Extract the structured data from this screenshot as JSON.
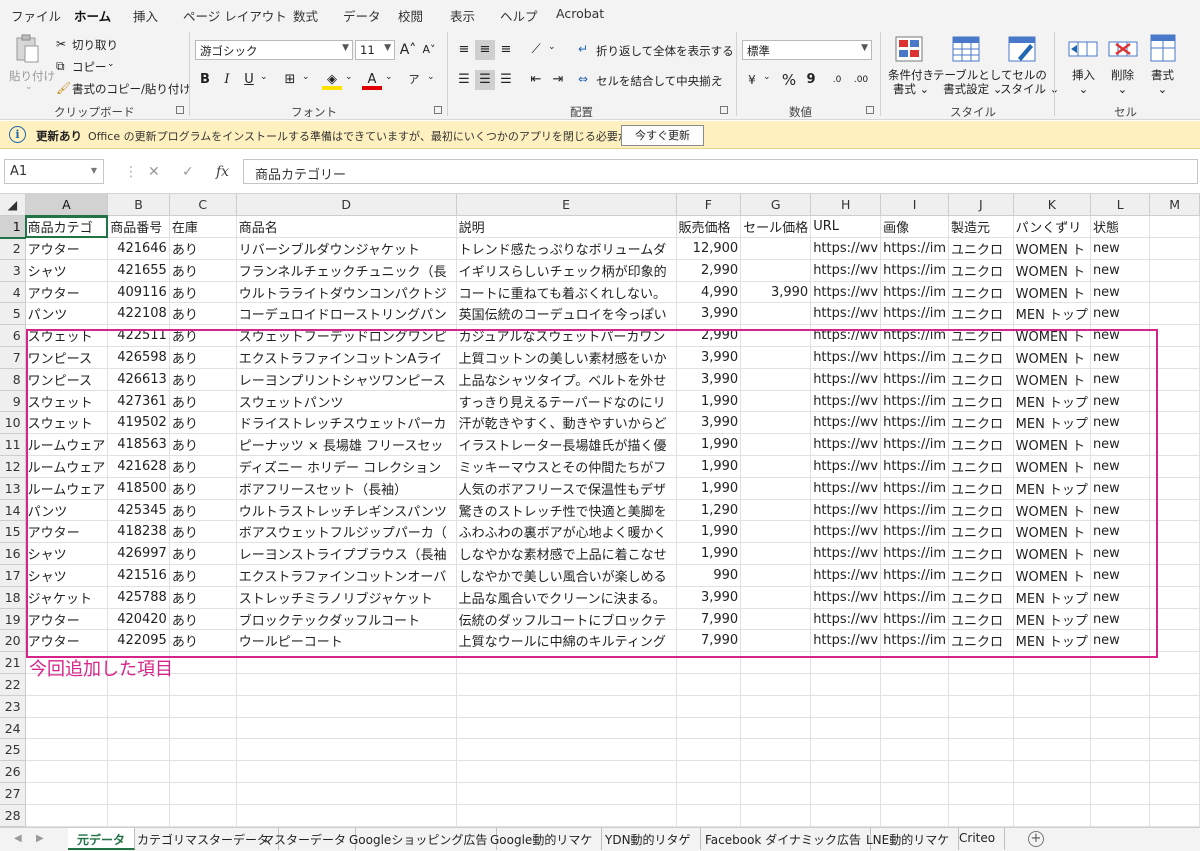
{
  "ribbon_tabs": [
    "ファイル",
    "ホーム",
    "挿入",
    "ページ レイアウト",
    "数式",
    "データ",
    "校閲",
    "表示",
    "ヘルプ",
    "Acrobat"
  ],
  "ribbon": {
    "clipboard": {
      "paste": "貼り付け",
      "cut": "切り取り",
      "copy": "コピー",
      "format_painter": "書式のコピー/貼り付け",
      "label": "クリップボード"
    },
    "font": {
      "font_name": "游ゴシック",
      "font_size": "11",
      "grow": "A",
      "shrink": "A",
      "bold": "B",
      "italic": "I",
      "underline": "U",
      "font_color_glyph": "A",
      "phonetic": "ア",
      "label": "フォント"
    },
    "alignment": {
      "wrap": "折り返して全体を表示する",
      "merge": "セルを結合して中央揃え",
      "label": "配置"
    },
    "number": {
      "format": "標準",
      "percent": "%",
      "comma": "9",
      "inc_decimal": ".0",
      "dec_decimal": ".00",
      "label": "数値"
    },
    "styles": {
      "conditional": [
        "条件付き",
        "書式"
      ],
      "table": [
        "テーブルとして",
        "書式設定"
      ],
      "cell_style": [
        "セルの",
        "スタイル"
      ],
      "label": "スタイル"
    },
    "cells": {
      "insert": "挿入",
      "delete": "削除",
      "format": "書式",
      "label": "セル"
    }
  },
  "update_bar": {
    "title": "更新あり",
    "message": "Office の更新プログラムをインストールする準備はできていますが、最初にいくつかのアプリを閉じる必要があります。",
    "button": "今すぐ更新"
  },
  "formula_bar": {
    "name_box": "A1",
    "fx": "fx",
    "value": "商品カテゴリー"
  },
  "columns": [
    "A",
    "B",
    "C",
    "D",
    "E",
    "F",
    "G",
    "H",
    "I",
    "J",
    "K",
    "L",
    "M"
  ],
  "rows": [
    [
      "商品カテゴ",
      "商品番号",
      "在庫",
      "商品名",
      "説明",
      "販売価格",
      "セール価格",
      "URL",
      "画像",
      "製造元",
      "パンくずリ",
      "状態"
    ],
    [
      "アウター",
      "421646",
      "あり",
      "リバーシブルダウンジャケット",
      "トレンド感たっぷりなボリュームダ",
      "12,900",
      "",
      "https://wv",
      "https://im",
      "ユニクロ",
      "WOMEN ト",
      "new"
    ],
    [
      "シャツ",
      "421655",
      "あり",
      "フランネルチェックチュニック（長",
      "イギリスらしいチェック柄が印象的",
      "2,990",
      "",
      "https://wv",
      "https://im",
      "ユニクロ",
      "WOMEN ト",
      "new"
    ],
    [
      "アウター",
      "409116",
      "あり",
      "ウルトラライトダウンコンパクトジ",
      "コートに重ねても着ぶくれしない。",
      "4,990",
      "3,990",
      "https://wv",
      "https://im",
      "ユニクロ",
      "WOMEN ト",
      "new"
    ],
    [
      "パンツ",
      "422108",
      "あり",
      "コーデュロイドローストリングパン",
      "英国伝統のコーデュロイを今っぽい",
      "3,990",
      "",
      "https://wv",
      "https://im",
      "ユニクロ",
      "MEN トップ",
      "new"
    ],
    [
      "スウェット",
      "422511",
      "あり",
      "スウェットフーデッドロングワンピ",
      "カジュアルなスウェットパーカワン",
      "2,990",
      "",
      "https://wv",
      "https://im",
      "ユニクロ",
      "WOMEN ト",
      "new"
    ],
    [
      "ワンピース",
      "426598",
      "あり",
      "エクストラファインコットンAライ",
      "上質コットンの美しい素材感をいか",
      "3,990",
      "",
      "https://wv",
      "https://im",
      "ユニクロ",
      "WOMEN ト",
      "new"
    ],
    [
      "ワンピース",
      "426613",
      "あり",
      "レーヨンプリントシャツワンピース",
      "上品なシャツタイプ。ベルトを外せ",
      "3,990",
      "",
      "https://wv",
      "https://im",
      "ユニクロ",
      "WOMEN ト",
      "new"
    ],
    [
      "スウェット",
      "427361",
      "あり",
      "スウェットパンツ",
      "すっきり見えるテーパードなのにリ",
      "1,990",
      "",
      "https://wv",
      "https://im",
      "ユニクロ",
      "MEN トップ",
      "new"
    ],
    [
      "スウェット",
      "419502",
      "あり",
      "ドライストレッチスウェットパーカ",
      "汗が乾きやすく、動きやすいからど",
      "3,990",
      "",
      "https://wv",
      "https://im",
      "ユニクロ",
      "MEN トップ",
      "new"
    ],
    [
      "ルームウェア",
      "418563",
      "あり",
      "ピーナッツ × 長場雄 フリースセッ",
      "イラストレーター長場雄氏が描く優",
      "1,990",
      "",
      "https://wv",
      "https://im",
      "ユニクロ",
      "WOMEN ト",
      "new"
    ],
    [
      "ルームウェア",
      "421628",
      "あり",
      "ディズニー ホリデー コレクション",
      "ミッキーマウスとその仲間たちがフ",
      "1,990",
      "",
      "https://wv",
      "https://im",
      "ユニクロ",
      "WOMEN ト",
      "new"
    ],
    [
      "ルームウェア",
      "418500",
      "あり",
      "ボアフリースセット（長袖）",
      "人気のボアフリースで保温性もデザ",
      "1,990",
      "",
      "https://wv",
      "https://im",
      "ユニクロ",
      "MEN トップ",
      "new"
    ],
    [
      "パンツ",
      "425345",
      "あり",
      "ウルトラストレッチレギンスパンツ",
      "驚きのストレッチ性で快適と美脚を",
      "1,290",
      "",
      "https://wv",
      "https://im",
      "ユニクロ",
      "WOMEN ト",
      "new"
    ],
    [
      "アウター",
      "418238",
      "あり",
      "ボアスウェットフルジップパーカ（",
      "ふわふわの裏ボアが心地よく暖かく",
      "1,990",
      "",
      "https://wv",
      "https://im",
      "ユニクロ",
      "WOMEN ト",
      "new"
    ],
    [
      "シャツ",
      "426997",
      "あり",
      "レーヨンストライプブラウス（長袖",
      "しなやかな素材感で上品に着こなせ",
      "1,990",
      "",
      "https://wv",
      "https://im",
      "ユニクロ",
      "WOMEN ト",
      "new"
    ],
    [
      "シャツ",
      "421516",
      "あり",
      "エクストラファインコットンオーバ",
      "しなやかで美しい風合いが楽しめる",
      "990",
      "",
      "https://wv",
      "https://im",
      "ユニクロ",
      "WOMEN ト",
      "new"
    ],
    [
      "ジャケット",
      "425788",
      "あり",
      "ストレッチミラノリブジャケット",
      "上品な風合いでクリーンに決まる。",
      "3,990",
      "",
      "https://wv",
      "https://im",
      "ユニクロ",
      "MEN トップ",
      "new"
    ],
    [
      "アウター",
      "420420",
      "あり",
      "ブロックテックダッフルコート",
      "伝統のダッフルコートにブロックテ",
      "7,990",
      "",
      "https://wv",
      "https://im",
      "ユニクロ",
      "MEN トップ",
      "new"
    ],
    [
      "アウター",
      "422095",
      "あり",
      "ウールピーコート",
      "上質なウールに中綿のキルティング",
      "7,990",
      "",
      "https://wv",
      "https://im",
      "ユニクロ",
      "MEN トップ",
      "new"
    ]
  ],
  "empty_row_numbers": [
    21,
    22,
    23,
    24,
    25,
    26,
    27,
    28
  ],
  "annotation": {
    "note": "今回追加した項目",
    "color": "#d6248a"
  },
  "sheet_tabs": [
    "元データ",
    "カテゴリマスターデータ",
    "マスターデータ",
    "Googleショッピング広告",
    "Google動的リマケ",
    "YDN動的リタゲ",
    "Facebook ダイナミック広告",
    "LNE動的リマケ",
    "Criteo"
  ],
  "colors": {
    "accent": "#217346",
    "highlight": "#d6248a",
    "update_bar": "#fff1bf"
  }
}
